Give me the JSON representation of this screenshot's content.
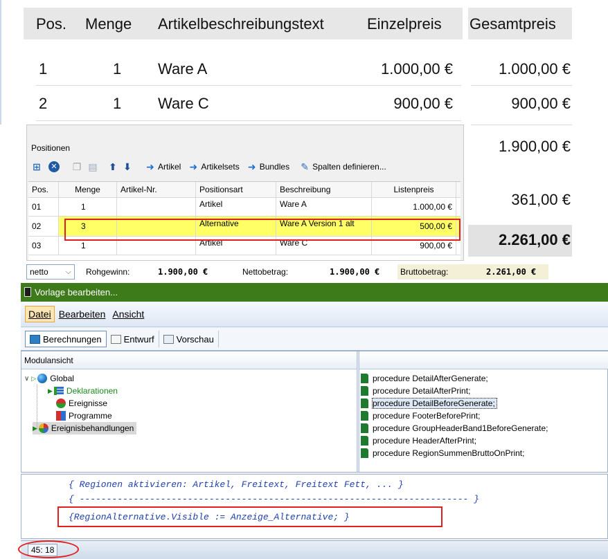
{
  "invoice": {
    "headers": [
      "Pos.",
      "Menge",
      "Artikelbeschreibungstext",
      "Einzelpreis",
      "Gesamtpreis"
    ],
    "rows": [
      {
        "pos": "1",
        "qty": "1",
        "desc": "Ware A",
        "unit": "1.000,00 €",
        "total": "1.000,00 €"
      },
      {
        "pos": "2",
        "qty": "1",
        "desc": "Ware C",
        "unit": "900,00 €",
        "total": "900,00 €"
      }
    ],
    "subtotal": "1.900,00 €",
    "tax": "361,00 €",
    "grand_total": "2.261,00 €"
  },
  "positions": {
    "title": "Positionen",
    "toolbar": {
      "artikel": "Artikel",
      "artikelsets": "Artikelsets",
      "bundles": "Bundles",
      "spalten": "Spalten definieren..."
    },
    "columns": [
      "Pos.",
      "Menge",
      "Artikel-Nr.",
      "Positionsart",
      "Beschreibung",
      "Listenpreis"
    ],
    "rows": [
      {
        "pos": "01",
        "menge": "1",
        "nr": "",
        "art": "Artikel",
        "beschr": "Ware A",
        "preis": "1.000,00 €"
      },
      {
        "pos": "02",
        "menge": "3",
        "nr": "",
        "art": "Alternative",
        "beschr": "Ware A Version 1 alt",
        "preis": "500,00 €"
      },
      {
        "pos": "03",
        "menge": "1",
        "nr": "",
        "art": "Artikel",
        "beschr": "Ware C",
        "preis": "900,00 €"
      }
    ]
  },
  "summary": {
    "mode": "netto",
    "rohgewinn_label": "Rohgewinn:",
    "rohgewinn": "1.900,00 €",
    "netto_label": "Nettobetrag:",
    "netto": "1.900,00 €",
    "brutto_label": "Bruttobetrag:",
    "brutto": "2.261,00 €"
  },
  "editor": {
    "title": "Vorlage bearbeiten...",
    "menu": [
      "Datei",
      "Bearbeiten",
      "Ansicht"
    ],
    "tabs": [
      "Berechnungen",
      "Entwurf",
      "Vorschau"
    ],
    "modul_header": "Modulansicht",
    "tree": {
      "global": "Global",
      "deklarationen": "Deklarationen",
      "ereignisse": "Ereignisse",
      "programme": "Programme",
      "ereignisbehandlungen": "Ereignisbehandlungen"
    },
    "procedures": [
      "procedure DetailAfterGenerate;",
      "procedure DetailAfterPrint;",
      "procedure DetailBeforeGenerate;",
      "procedure FooterBeforePrint;",
      "procedure GroupHeaderBand1BeforeGenerate;",
      "procedure HeaderAfterPrint;",
      "procedure RegionSummenBruttoOnPrint;"
    ],
    "code": [
      "{ Regionen aktivieren: Artikel, Freitext, Freitext Fett, ... }",
      "{ ------------------------------------------------------------------------ }",
      "{RegionAlternative.Visible := Anzeige_Alternative; }"
    ],
    "status": "45: 18"
  },
  "colors": {
    "titlebar": "#3d7a1a",
    "highlight_red": "#e31e1e",
    "row_yellow": "#ffff66",
    "code_blue": "#1f3fae"
  }
}
